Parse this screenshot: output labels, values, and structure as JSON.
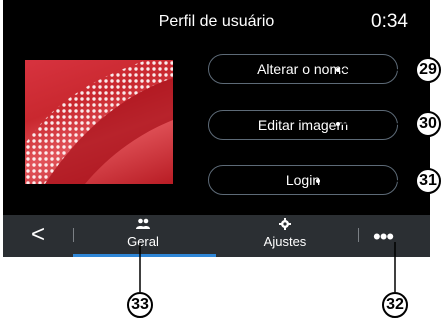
{
  "screen": {
    "title": "Perfil de usuário",
    "clock": "0:34"
  },
  "actions": {
    "rename_label": "Alterar o nome",
    "edit_image_label": "Editar imagem",
    "login_label": "Login"
  },
  "tabbar": {
    "back_glyph": "<",
    "tabs": [
      {
        "label": "Geral",
        "icon": "people-icon",
        "selected": true
      },
      {
        "label": "Ajustes",
        "icon": "gear-icon",
        "selected": false
      }
    ],
    "more_glyph": "•••"
  },
  "callouts": {
    "c29": "29",
    "c30": "30",
    "c31": "31",
    "c32": "32",
    "c33": "33"
  },
  "colors": {
    "screen_bg": "#000000",
    "tabbar_bg": "#2b2f33",
    "accent_underline": "#2f86d6",
    "button_border": "#5d6a77",
    "profile_image_red": "#c9282f"
  }
}
